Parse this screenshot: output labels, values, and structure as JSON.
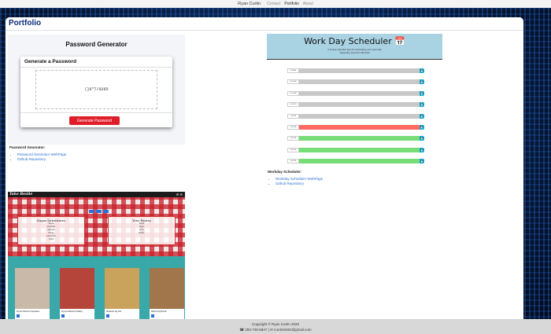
{
  "nav": {
    "brand": "Ryan Curtin",
    "links": [
      "Contact",
      "Portfolio",
      "About"
    ],
    "active": "Portfolio"
  },
  "page_title": "Portfolio",
  "password_project": {
    "screenshot": {
      "header": "Password Generator",
      "card_title": "Generate a Password",
      "password_value": "(}6\"7/0265",
      "button_label": "Generate Password"
    },
    "label": "Password Generator:",
    "links": [
      "Password Generator WebPage",
      "Github Repository"
    ]
  },
  "scheduler_project": {
    "screenshot": {
      "title": "Work Day Scheduler 📅",
      "subtitle": "A simple calendar app for scheduling your work day",
      "date": "Wednesday, December 18th 2020",
      "hours": [
        {
          "label": "9:00 AM",
          "state": "past"
        },
        {
          "label": "10:00 AM",
          "state": "past"
        },
        {
          "label": "11:00 AM",
          "state": "past"
        },
        {
          "label": "12:00 PM",
          "state": "past"
        },
        {
          "label": "1:00 PM",
          "state": "past"
        },
        {
          "label": "2:00 PM",
          "state": "present"
        },
        {
          "label": "3:00 PM",
          "state": "future"
        },
        {
          "label": "4:00 PM",
          "state": "future"
        },
        {
          "label": "5:00 PM",
          "state": "future"
        }
      ],
      "colors": {
        "past": "#c8c8c8",
        "present": "#ff6961",
        "future": "#77dd77"
      }
    },
    "label": "Workday Scheduler:",
    "links": [
      "Workday Scheduler WebPage",
      "Github Repository"
    ]
  },
  "recipe_project": {
    "logo": "Take Bestie",
    "list_left_title": "Sugar Substitutes",
    "list_left_items": [
      "Stevia",
      "Erythritol",
      "Splenda",
      "Honey",
      "Monk fruit",
      "Xylitol"
    ],
    "list_right_title": "Your Pantry",
    "list_right_items": [
      "Sugar",
      "Eggs",
      "Flour",
      "Butter"
    ],
    "cards": [
      {
        "name": "Fig and Almond Cupcakes",
        "color": "#c8b9a8"
      },
      {
        "name": "Fig and Walnut Pudding",
        "color": "#b5443a"
      },
      {
        "name": "Pistachio Fig Tart",
        "color": "#c9a25c"
      },
      {
        "name": "Walnut Fig Bread",
        "color": "#a0764a"
      }
    ]
  },
  "footer": {
    "copyright": "Copyright © Ryan Curtin 2020",
    "contact": "☎ 203-725-5847 | ✉ rcurtin0491@gmail.com"
  }
}
